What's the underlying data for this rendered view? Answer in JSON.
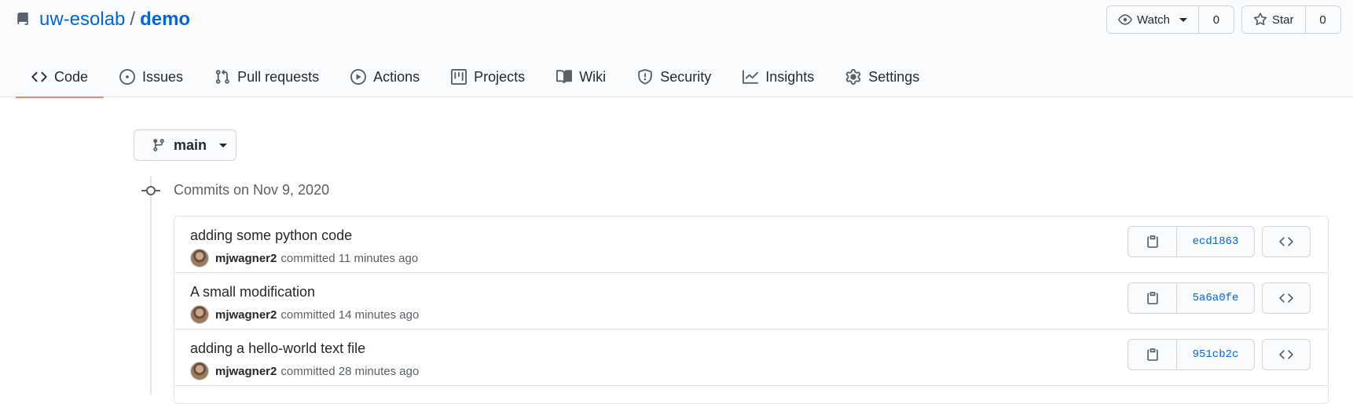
{
  "repo": {
    "owner": "uw-esolab",
    "separator": "/",
    "name": "demo"
  },
  "actions": {
    "watch_label": "Watch",
    "watch_count": "0",
    "star_label": "Star",
    "star_count": "0"
  },
  "tabs": [
    {
      "label": "Code",
      "icon": "code-icon",
      "active": true
    },
    {
      "label": "Issues",
      "icon": "issue-opened-icon"
    },
    {
      "label": "Pull requests",
      "icon": "git-pull-request-icon"
    },
    {
      "label": "Actions",
      "icon": "play-icon"
    },
    {
      "label": "Projects",
      "icon": "project-icon"
    },
    {
      "label": "Wiki",
      "icon": "book-icon"
    },
    {
      "label": "Security",
      "icon": "shield-icon"
    },
    {
      "label": "Insights",
      "icon": "graph-icon"
    },
    {
      "label": "Settings",
      "icon": "gear-icon"
    }
  ],
  "branch": {
    "name": "main"
  },
  "commits_group": {
    "title": "Commits on Nov 9, 2020",
    "commits": [
      {
        "message": "adding some python code",
        "author": "mjwagner2",
        "verb": "committed",
        "time": "11 minutes ago",
        "sha": "ecd1863"
      },
      {
        "message": "A small modification",
        "author": "mjwagner2",
        "verb": "committed",
        "time": "14 minutes ago",
        "sha": "5a6a0fe"
      },
      {
        "message": "adding a hello-world text file",
        "author": "mjwagner2",
        "verb": "committed",
        "time": "28 minutes ago",
        "sha": "951cb2c"
      }
    ]
  },
  "colors": {
    "link": "#0366d6",
    "active_tab_underline": "#f9826c",
    "header_bg": "#fafbfc"
  }
}
